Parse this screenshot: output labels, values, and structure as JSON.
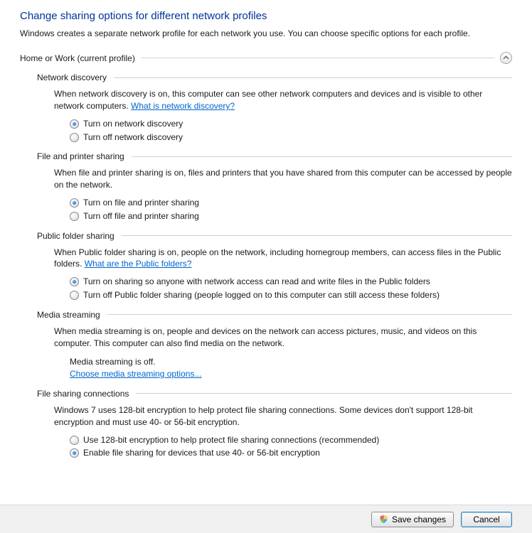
{
  "page": {
    "title": "Change sharing options for different network profiles",
    "intro": "Windows creates a separate network profile for each network you use. You can choose specific options for each profile."
  },
  "profile": {
    "label": "Home or Work (current profile)"
  },
  "sections": {
    "networkDiscovery": {
      "title": "Network discovery",
      "desc": "When network discovery is on, this computer can see other network computers and devices and is visible to other network computers. ",
      "linkText": "What is network discovery?",
      "opt1": "Turn on network discovery",
      "opt2": "Turn off network discovery"
    },
    "filePrinter": {
      "title": "File and printer sharing",
      "desc": "When file and printer sharing is on, files and printers that you have shared from this computer can be accessed by people on the network.",
      "opt1": "Turn on file and printer sharing",
      "opt2": "Turn off file and printer sharing"
    },
    "publicFolder": {
      "title": "Public folder sharing",
      "desc": "When Public folder sharing is on, people on the network, including homegroup members, can access files in the Public folders. ",
      "linkText": "What are the Public folders?",
      "opt1": "Turn on sharing so anyone with network access can read and write files in the Public folders",
      "opt2": "Turn off Public folder sharing (people logged on to this computer can still access these folders)"
    },
    "mediaStreaming": {
      "title": "Media streaming",
      "desc": "When media streaming is on, people and devices on the network can access pictures, music, and videos on this computer. This computer can also find media on the network.",
      "status": "Media streaming is off.",
      "linkText": "Choose media streaming options..."
    },
    "fileSharingConn": {
      "title": "File sharing connections",
      "desc": "Windows 7 uses 128-bit encryption to help protect file sharing connections. Some devices don't support 128-bit encryption and must use 40- or 56-bit encryption.",
      "opt1": "Use 128-bit encryption to help protect file sharing connections (recommended)",
      "opt2": "Enable file sharing for devices that use 40- or 56-bit encryption"
    }
  },
  "footer": {
    "save": "Save changes",
    "cancel": "Cancel"
  }
}
